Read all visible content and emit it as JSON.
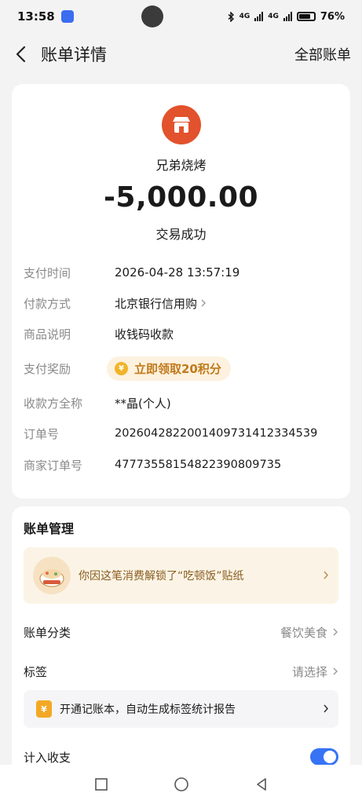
{
  "status_bar": {
    "time": "13:58",
    "network_1": "4G",
    "network_2": "4G",
    "battery": "76%"
  },
  "header": {
    "title": "账单详情",
    "right_link": "全部账单"
  },
  "transaction": {
    "merchant_name": "兄弟烧烤",
    "amount": "-5,000.00",
    "status": "交易成功",
    "logo_color": "#e2522c"
  },
  "details": {
    "pay_time_label": "支付时间",
    "pay_time_value": "2026-04-28 13:57:19",
    "pay_method_label": "付款方式",
    "pay_method_value": "北京银行信用购",
    "product_label": "商品说明",
    "product_value": "收钱码收款",
    "reward_label": "支付奖励",
    "reward_value": "立即领取20积分",
    "payee_label": "收款方全称",
    "payee_value": "**晶(个人)",
    "order_label": "订单号",
    "order_value": "20260428220014097314123345 39",
    "merchant_order_label": "商家订单号",
    "merchant_order_value": "4777355815482239080973 5"
  },
  "management": {
    "title": "账单管理",
    "sticker_text": "你因这笔消费解锁了“吃顿饭”贴纸",
    "category_label": "账单分类",
    "category_value": "餐饮美食",
    "tag_label": "标签",
    "tag_value": "请选择",
    "promo_text": "开通记账本，自动生成标签统计报告",
    "include_label": "计入收支",
    "include_on": true
  },
  "colors": {
    "accent": "#3773f5",
    "reward": "#c07a1a",
    "merchant": "#e2522c"
  }
}
